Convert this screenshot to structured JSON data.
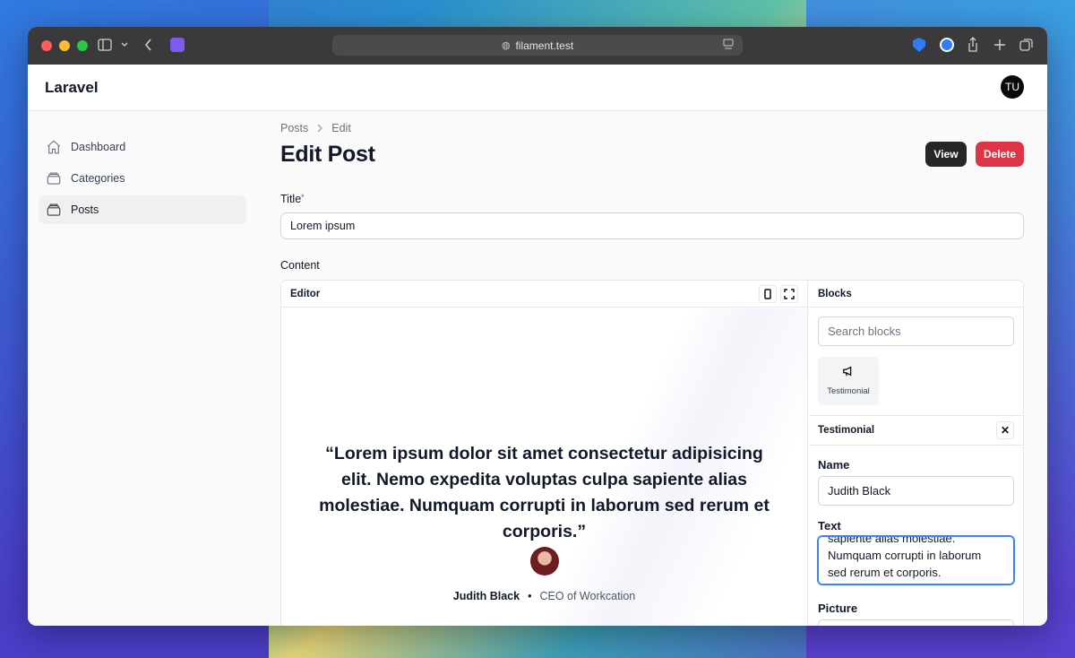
{
  "browser": {
    "url": "filament.test"
  },
  "app": {
    "brand": "Laravel",
    "user_initials": "TU"
  },
  "sidebar": {
    "items": [
      {
        "label": "Dashboard",
        "icon": "home-icon",
        "active": false
      },
      {
        "label": "Categories",
        "icon": "rectangle-stack-icon",
        "active": false
      },
      {
        "label": "Posts",
        "icon": "rectangle-stack-icon",
        "active": true
      }
    ]
  },
  "breadcrumb": [
    "Posts",
    "Edit"
  ],
  "page": {
    "title": "Edit Post",
    "view_label": "View",
    "delete_label": "Delete"
  },
  "form": {
    "title_label": "Title",
    "title_value": "Lorem ipsum",
    "content_label": "Content"
  },
  "editor": {
    "header": "Editor",
    "quote": "“Lorem ipsum dolor sit amet consectetur adipisicing elit. Nemo expedita voluptas culpa sapiente alias molestiae. Numquam corrupti in laborum sed rerum et corporis.”",
    "author_name": "Judith Black",
    "separator": "•",
    "author_role": "CEO of Workcation"
  },
  "blocks": {
    "header": "Blocks",
    "search_placeholder": "Search blocks",
    "tiles": [
      {
        "label": "Testimonial",
        "icon": "megaphone-icon"
      }
    ],
    "selected_header": "Testimonial",
    "name_label": "Name",
    "name_value": "Judith Black",
    "text_label": "Text",
    "text_line1": "sapiente alias molestiae.",
    "text_line2": "Numquam corrupti in laborum",
    "text_line3": "sed rerum et corporis.",
    "picture_label": "Picture"
  },
  "colors": {
    "primary_dark": "#262626",
    "danger": "#dc3545",
    "focus": "#3b82f6"
  }
}
